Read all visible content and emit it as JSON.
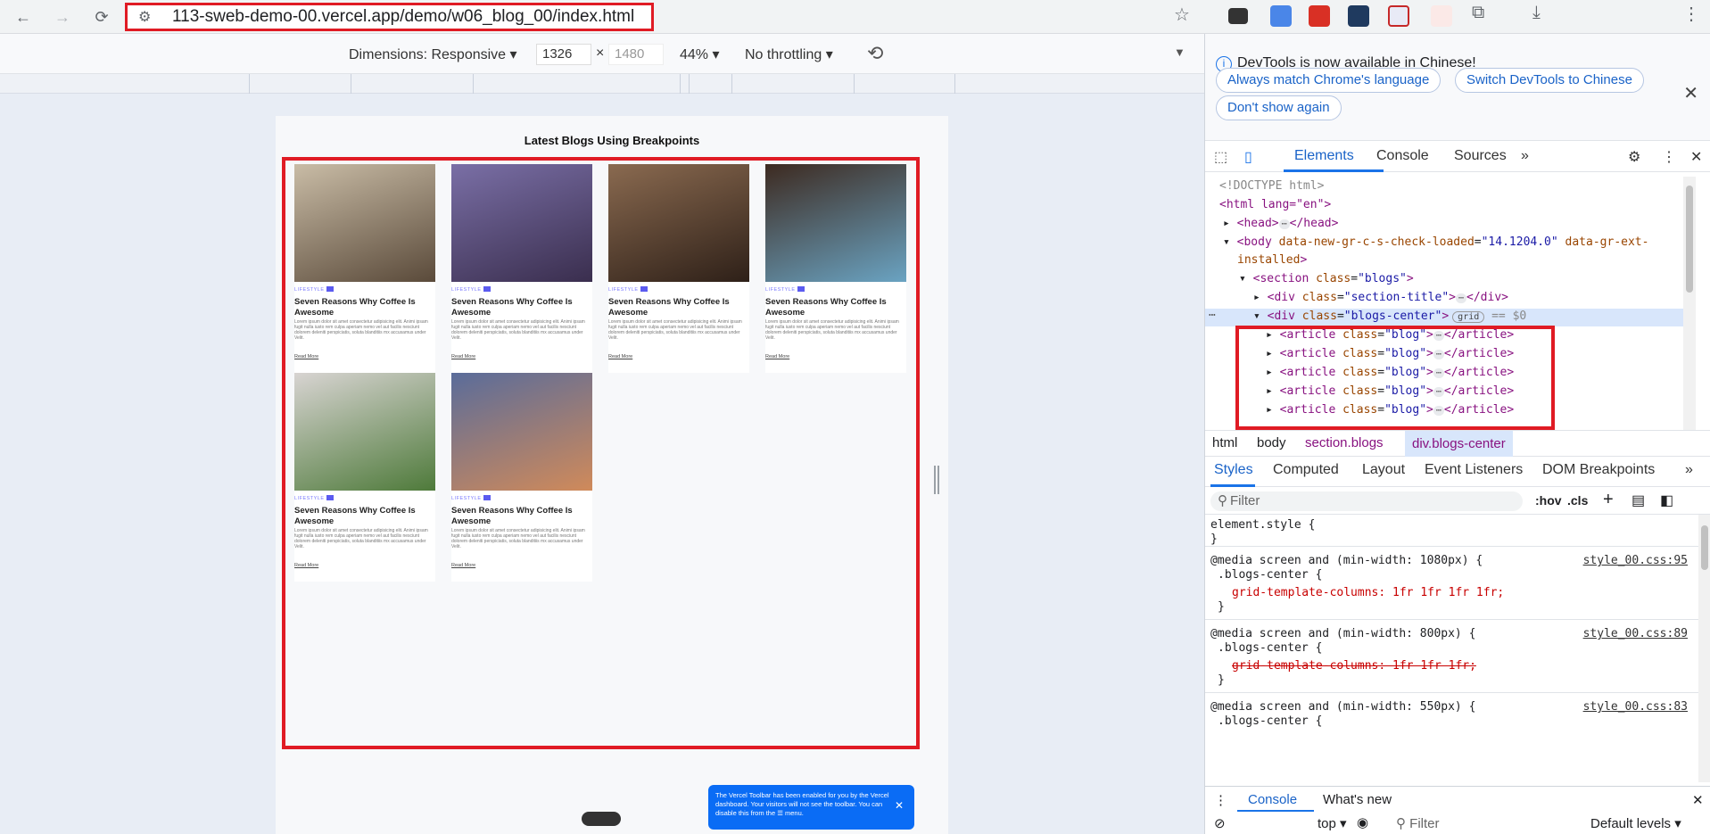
{
  "browser": {
    "url": "113-sweb-demo-00.vercel.app/demo/w06_blog_00/index.html"
  },
  "device_toolbar": {
    "dimensions_label": "Dimensions: Responsive",
    "width": "1326",
    "times": "×",
    "height": "1480",
    "zoom": "44%",
    "throttling": "No throttling"
  },
  "page": {
    "title": "Latest Blogs Using Breakpoints",
    "blogs": [
      {
        "category": "LIFESTYLE",
        "title": "Seven Reasons Why Coffee Is Awesome",
        "desc": "Lorem ipsum dolor sit amet consectetur adipisicing elit. Animi ipsam fugit nulla iusto rem culpa aperiam nemo vel aut facilis nesciunt dolorem deleniti perspiciatis, soluta blanditiis mx accusamus under Velit.",
        "read_more": "Read More",
        "color_a": "#c9bca6",
        "color_b": "#5a4a3a"
      },
      {
        "category": "LIFESTYLE",
        "title": "Seven Reasons Why Coffee Is Awesome",
        "desc": "Lorem ipsum dolor sit amet consectetur adipisicing elit. Animi ipsam fugit nulla iusto rem culpa aperiam nemo vel aut facilis nesciunt dolorem deleniti perspiciatis, soluta blanditiis mx accusamus under Velit.",
        "read_more": "Read More",
        "color_a": "#7a6fa6",
        "color_b": "#3a2e4e"
      },
      {
        "category": "LIFESTYLE",
        "title": "Seven Reasons Why Coffee Is Awesome",
        "desc": "Lorem ipsum dolor sit amet consectetur adipisicing elit. Animi ipsam fugit nulla iusto rem culpa aperiam nemo vel aut facilis nesciunt dolorem deleniti perspiciatis, soluta blanditiis mx accusamus under Velit.",
        "read_more": "Read More",
        "color_a": "#8a6a50",
        "color_b": "#2e2018"
      },
      {
        "category": "LIFESTYLE",
        "title": "Seven Reasons Why Coffee Is Awesome",
        "desc": "Lorem ipsum dolor sit amet consectetur adipisicing elit. Animi ipsam fugit nulla iusto rem culpa aperiam nemo vel aut facilis nesciunt dolorem deleniti perspiciatis, soluta blanditiis mx accusamus under Velit.",
        "read_more": "Read More",
        "color_a": "#3d2a20",
        "color_b": "#6aa3c2"
      },
      {
        "category": "LIFESTYLE",
        "title": "Seven Reasons Why Coffee Is Awesome",
        "desc": "Lorem ipsum dolor sit amet consectetur adipisicing elit. Animi ipsam fugit nulla iusto rem culpa aperiam nemo vel aut facilis nesciunt dolorem deleniti perspiciatis, soluta blanditiis mx accusamus under Velit.",
        "read_more": "Read More",
        "color_a": "#d8d4d2",
        "color_b": "#4e7a3a"
      },
      {
        "category": "LIFESTYLE",
        "title": "Seven Reasons Why Coffee Is Awesome",
        "desc": "Lorem ipsum dolor sit amet consectetur adipisicing elit. Animi ipsam fugit nulla iusto rem culpa aperiam nemo vel aut facilis nesciunt dolorem deleniti perspiciatis, soluta blanditiis mx accusamus under Velit.",
        "read_more": "Read More",
        "color_a": "#5a6c9a",
        "color_b": "#d08a5a"
      }
    ],
    "toast": "The Vercel Toolbar has been enabled for you by the Vercel dashboard. Your visitors will not see the toolbar. You can disable this from the ☰ menu."
  },
  "devtools": {
    "banner": {
      "message": "DevTools is now available in Chinese!",
      "btn_match": "Always match Chrome's language",
      "btn_switch": "Switch DevTools to Chinese",
      "btn_dont": "Don't show again"
    },
    "tabs": [
      "Elements",
      "Console",
      "Sources"
    ],
    "dom": {
      "doctype": "<!DOCTYPE html>",
      "html_open": "<html lang=\"en\">",
      "head": "<head>",
      "head_close": "</head>",
      "body_tag": "<body",
      "body_attr1": "data-new-gr-c-s-check-loaded",
      "body_val1": "\"14.1204.0\"",
      "body_attr2": "data-gr-ext-",
      "body_attr2b": "installed",
      "section": "<section",
      "section_class": "class",
      "section_val": "\"blogs\"",
      "div_title_val": "\"section-title\"",
      "div_center_val": "\"blogs-center\"",
      "grid": "grid",
      "eq": "== $0",
      "article_val": "\"blog\"",
      "article_close": "</article>"
    },
    "crumbs": [
      "html",
      "body",
      "section.blogs",
      "div.blogs-center"
    ],
    "sub_tabs": [
      "Styles",
      "Computed",
      "Layout",
      "Event Listeners",
      "DOM Breakpoints"
    ],
    "filter_placeholder": "Filter",
    "hov": ":hov",
    "cls": ".cls",
    "styles": {
      "element_style": "element.style {",
      "close": "}",
      "m1": "@media screen and (min-width: 1080px) {",
      "m1_src": "style_00.css:95",
      "m1_prop": "grid-template-columns: 1fr 1fr 1fr 1fr;",
      "m2": "@media screen and (min-width: 800px) {",
      "m2_src": "style_00.css:89",
      "m2_prop": "grid-template-columns: 1fr 1fr 1fr;",
      "m3": "@media screen and (min-width: 550px) {",
      "m3_src": "style_00.css:83",
      "sel": ".blogs-center {"
    },
    "drawer": {
      "console": "Console",
      "whats_new": "What's new",
      "top": "top",
      "filter": "Filter",
      "levels": "Default levels"
    }
  }
}
